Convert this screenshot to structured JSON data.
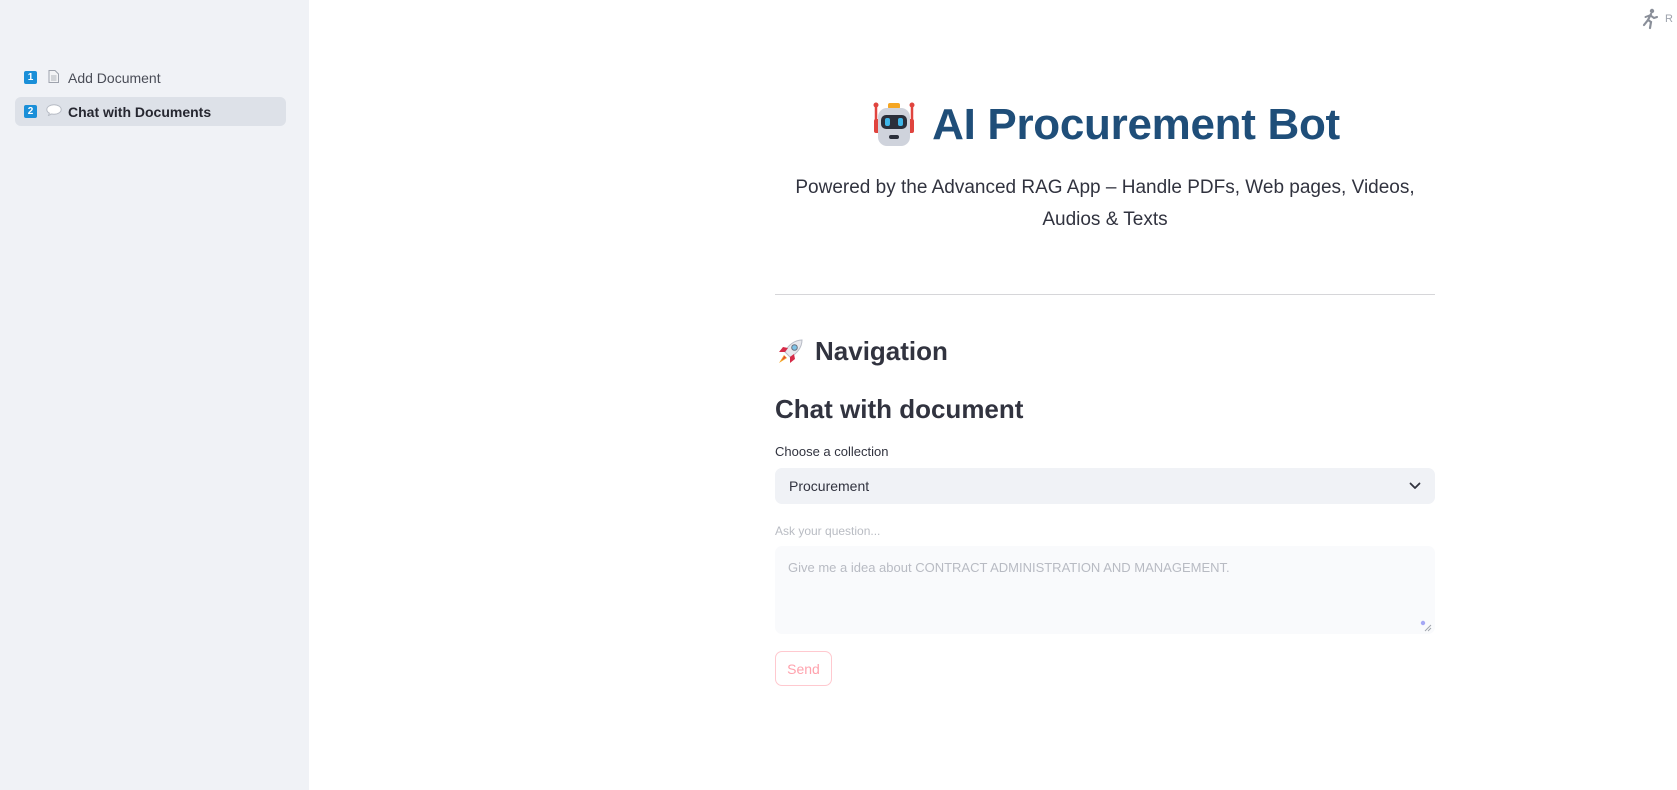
{
  "sidebar": {
    "items": [
      {
        "num": "1",
        "icon": "document-icon",
        "label": "Add Document",
        "active": false
      },
      {
        "num": "2",
        "icon": "speech-bubble-icon",
        "label": "Chat with Documents",
        "active": true
      }
    ]
  },
  "status": {
    "icon": "running-man-icon",
    "text": "R"
  },
  "header": {
    "icon": "robot-icon",
    "title": "AI Procurement Bot",
    "subtitle": "Powered by the Advanced RAG App – Handle PDFs, Web pages, Videos, Audios & Texts"
  },
  "navigation": {
    "icon": "rocket-icon",
    "heading": "Navigation"
  },
  "chat": {
    "heading": "Chat with document",
    "collection_label": "Choose a collection",
    "collection_value": "Procurement",
    "question_label": "Ask your question...",
    "question_placeholder": "Give me a idea about CONTRACT ADMINISTRATION AND MANAGEMENT.",
    "send_label": "Send"
  },
  "colors": {
    "title": "#1f4e79",
    "sidebar_bg": "#f0f2f6",
    "send_border": "#ffc9cf",
    "nav_number_bg": "#1a8fd8"
  }
}
